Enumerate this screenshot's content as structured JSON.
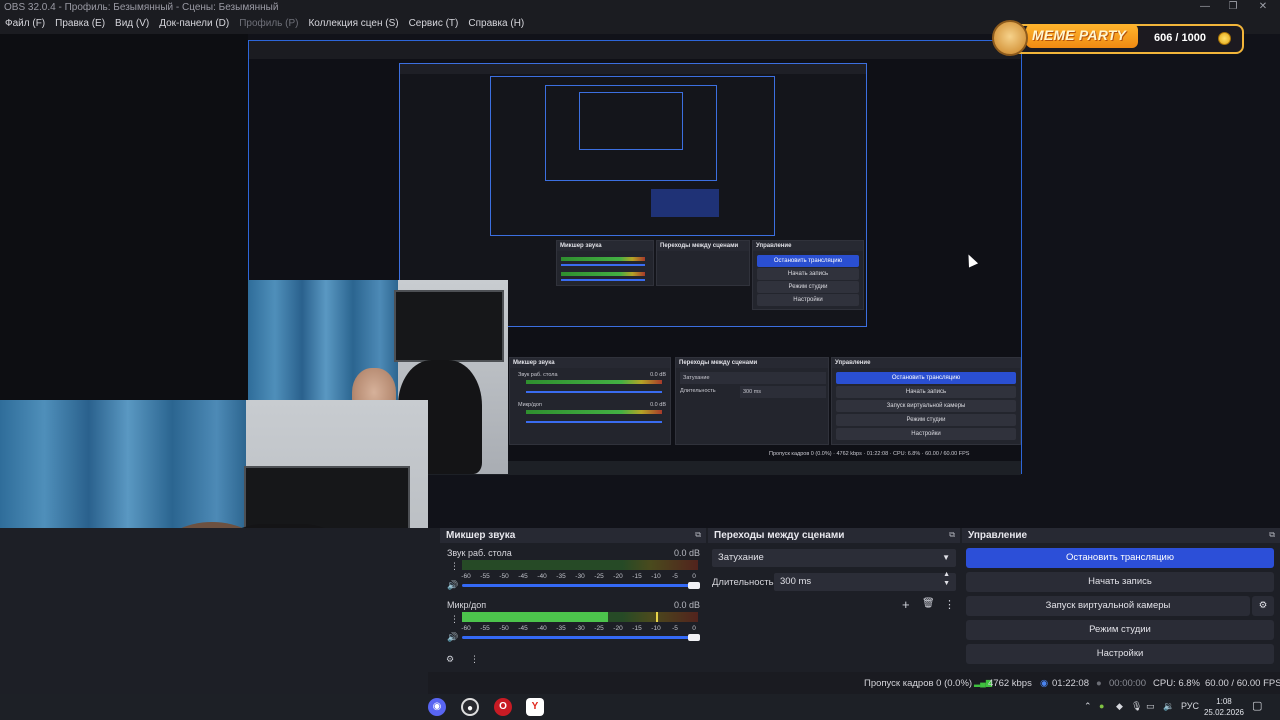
{
  "window": {
    "title": "OBS 32.0.4 - Профиль: Безымянный - Сцены: Безымянный",
    "minimize": "—",
    "maximize": "❐",
    "close": "✕"
  },
  "menu": [
    {
      "label": "Файл (F)",
      "enabled": true
    },
    {
      "label": "Правка (E)",
      "enabled": true
    },
    {
      "label": "Вид (V)",
      "enabled": true
    },
    {
      "label": "Док-панели (D)",
      "enabled": true
    },
    {
      "label": "Профиль (P)",
      "enabled": false
    },
    {
      "label": "Коллекция сцен (S)",
      "enabled": true
    },
    {
      "label": "Сервис (T)",
      "enabled": true
    },
    {
      "label": "Справка (H)",
      "enabled": true
    }
  ],
  "overlay": {
    "brand": "MEME PARTY",
    "score": "606 / 1000",
    "icon": "doge-icon"
  },
  "mixer": {
    "title": "Микшер звука",
    "ticks": [
      "-60",
      "-55",
      "-50",
      "-45",
      "-40",
      "-35",
      "-30",
      "-25",
      "-20",
      "-15",
      "-10",
      "-5",
      "0"
    ],
    "tracks": [
      {
        "name": "Звук раб. стола",
        "db": "0.0 dB",
        "level": 0.0,
        "peak": 0.0,
        "volume": 1.0
      },
      {
        "name": "Микр/доп",
        "db": "0.0 dB",
        "level": 0.62,
        "peak": 0.82,
        "volume": 1.0
      }
    ]
  },
  "transitions": {
    "title": "Переходы между сценами",
    "selected": "Затухание",
    "duration_label": "Длительность",
    "duration_value": "300 ms"
  },
  "controls": {
    "title": "Управление",
    "buttons": [
      {
        "label": "Остановить трансляцию",
        "primary": true
      },
      {
        "label": "Начать запись",
        "primary": false
      },
      {
        "label": "Запуск виртуальной камеры",
        "primary": false
      },
      {
        "label": "Режим студии",
        "primary": false
      },
      {
        "label": "Настройки",
        "primary": false
      }
    ]
  },
  "status": {
    "dropped": "Пропуск кадров 0 (0.0%)",
    "bitrate": "4762 kbps",
    "stream_time": "01:22:08",
    "rec_time": "00:00:00",
    "cpu": "CPU: 6.8%",
    "fps": "60.00 / 60.00 FPS"
  },
  "taskbar": {
    "apps": [
      "discord-icon",
      "obs-icon",
      "opera-icon",
      "yandex-icon"
    ],
    "lang": "РУС",
    "time": "1:08",
    "date": "25.02.2026"
  },
  "colors": {
    "accent": "#2c4fd8",
    "selection_border": "#2d66d9",
    "meter_green": "#4cc44c",
    "overlay_orange": "#f08a12"
  }
}
